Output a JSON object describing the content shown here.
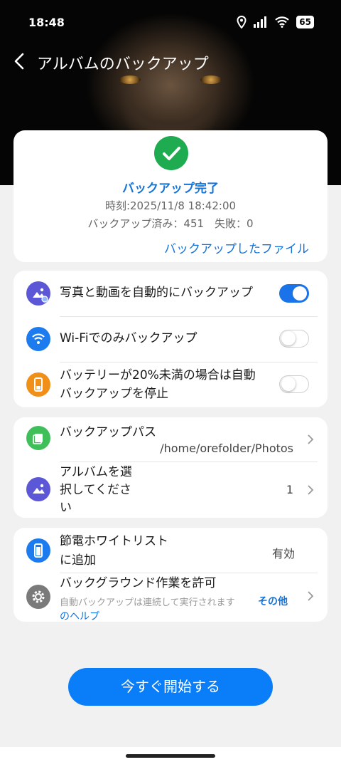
{
  "status_bar": {
    "time": "18:48",
    "battery": "65"
  },
  "header": {
    "title": "アルバムのバックアップ"
  },
  "backup_status": {
    "title": "バックアップ完了",
    "time_line": "時刻:2025/11/8 18:42:00",
    "count_line": "バックアップ済み：451　失敗：0",
    "link": "バックアップしたファイル"
  },
  "settings": {
    "auto_backup": {
      "label": "写真と動画を自動的にバックアップ",
      "enabled": true
    },
    "wifi_only": {
      "label": "Wi-Fiでのみバックアップ",
      "enabled": false
    },
    "battery_stop": {
      "line1": "バッテリーが20%未満の場合は自動",
      "line2": "バックアップを停止",
      "enabled": false
    }
  },
  "paths": {
    "backup_path": {
      "label": "バックアップパス",
      "value": "/home/orefolder/Photos"
    },
    "album_select": {
      "line1": "アルバムを選",
      "line2": "択してくださ",
      "line3": "い",
      "value": "1"
    }
  },
  "extra": {
    "power_whitelist": {
      "line1": "節電ホワイトリスト",
      "line2": "に追加",
      "value": "有効"
    },
    "background": {
      "label": "バックグラウンド作業を許可",
      "desc": "自動バックアップは連続して実行されます",
      "help1": "その他",
      "help2": "のヘルプ"
    }
  },
  "start_button": {
    "label": "今すぐ開始する"
  },
  "colors": {
    "accent": "#1574d9",
    "button": "#0a7df8",
    "success": "#1fab4f"
  }
}
